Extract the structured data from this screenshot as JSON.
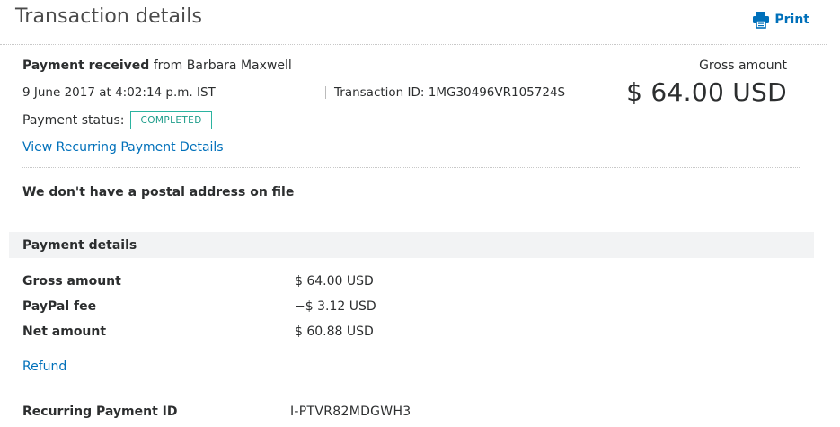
{
  "header": {
    "title": "Transaction details",
    "print_label": "Print"
  },
  "summary": {
    "payment_received": "Payment received",
    "from_text": "from Barbara Maxwell",
    "date": "9 June 2017 at 4:02:14 p.m. IST",
    "transaction_id_label": "Transaction ID:",
    "transaction_id": "1MG30496VR105724S",
    "status_label": "Payment status:",
    "status": "COMPLETED",
    "recurring_link": "View Recurring Payment Details",
    "gross_label": "Gross amount",
    "gross_value": "$ 64.00 USD"
  },
  "postal": {
    "text": "We don't have a postal address on file"
  },
  "payment_details": {
    "title": "Payment details",
    "rows": [
      {
        "label": "Gross amount",
        "value": "$ 64.00 USD"
      },
      {
        "label": "PayPal fee",
        "value": "−$ 3.12 USD"
      },
      {
        "label": "Net amount",
        "value": "$ 60.88 USD"
      }
    ],
    "refund_label": "Refund"
  },
  "recurring": {
    "label": "Recurring Payment ID",
    "value": "I-PTVR82MDGWH3"
  },
  "colors": {
    "link": "#0070ba",
    "status_border": "#2bb3a0",
    "section_bg": "#f2f3f4"
  },
  "icons": {
    "print": "printer-icon"
  }
}
